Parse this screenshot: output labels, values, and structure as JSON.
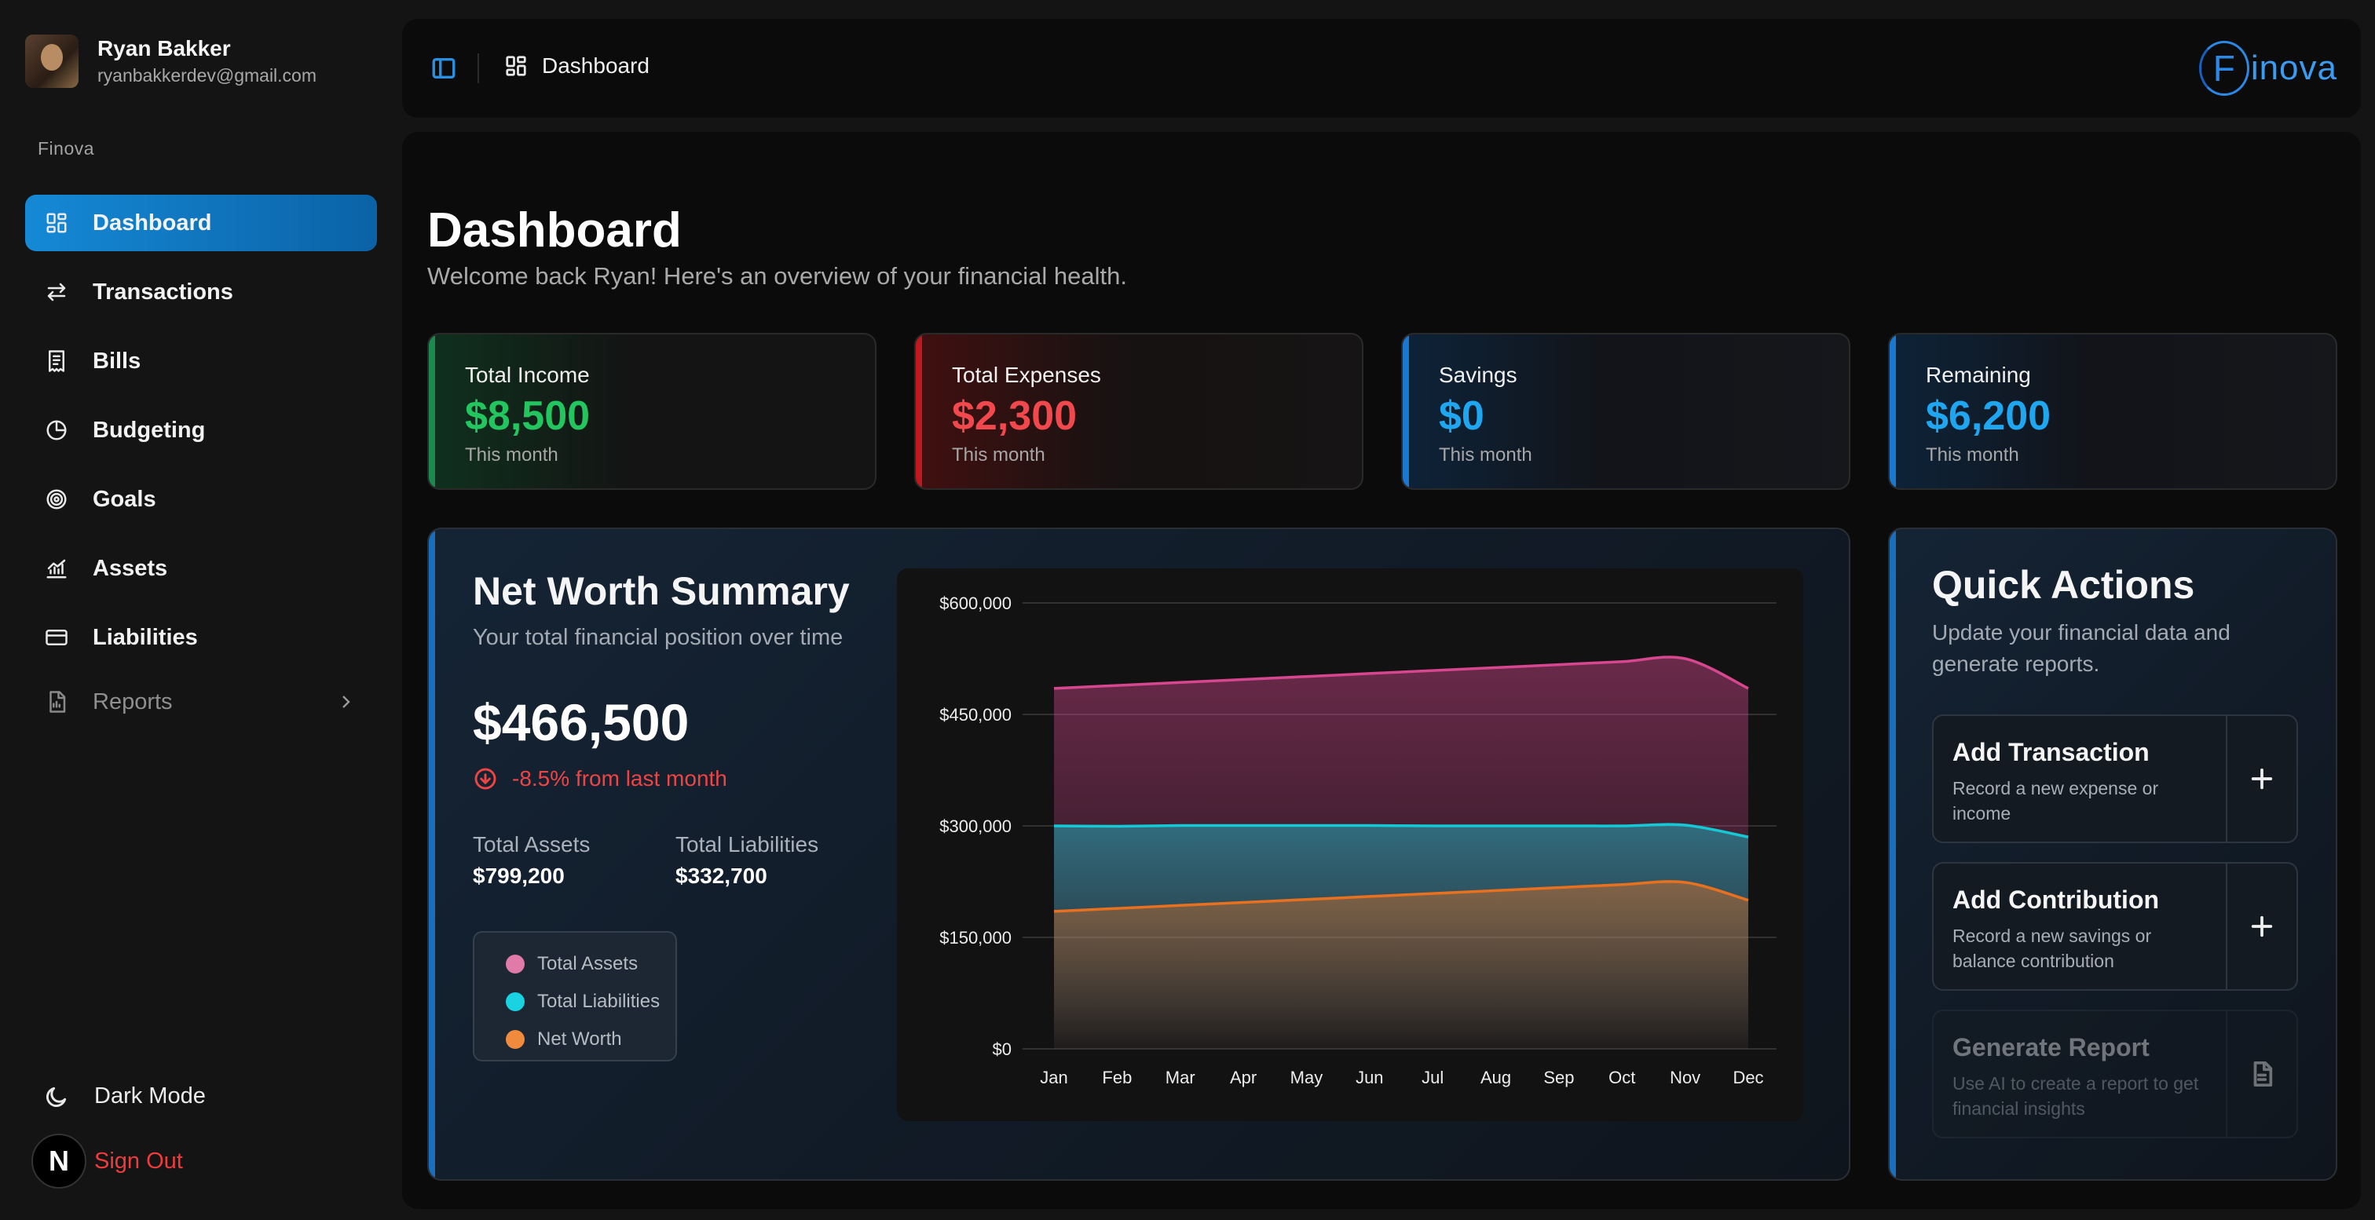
{
  "user": {
    "name": "Ryan Bakker",
    "email": "ryanbakkerdev@gmail.com"
  },
  "sidebar": {
    "section_label": "Finova",
    "items": [
      {
        "label": "Dashboard",
        "icon": "dashboard-icon",
        "active": true
      },
      {
        "label": "Transactions",
        "icon": "arrows-swap-icon"
      },
      {
        "label": "Bills",
        "icon": "receipt-icon"
      },
      {
        "label": "Budgeting",
        "icon": "pie-chart-icon"
      },
      {
        "label": "Goals",
        "icon": "target-icon"
      },
      {
        "label": "Assets",
        "icon": "bar-chart-icon"
      },
      {
        "label": "Liabilities",
        "icon": "credit-card-icon"
      },
      {
        "label": "Reports",
        "icon": "report-icon",
        "expandable": true
      }
    ],
    "dark_mode_label": "Dark Mode",
    "sign_out_label": "Sign Out",
    "badge_letter": "N"
  },
  "topbar": {
    "breadcrumb": "Dashboard",
    "logo_letter": "F",
    "logo_text": "inova"
  },
  "page": {
    "title": "Dashboard",
    "subtitle": "Welcome back Ryan! Here's an overview of your financial health."
  },
  "stats": [
    {
      "label": "Total Income",
      "value": "$8,500",
      "note": "This month",
      "color": "#22c55e"
    },
    {
      "label": "Total Expenses",
      "value": "$2,300",
      "note": "This month",
      "color": "#f0484d"
    },
    {
      "label": "Savings",
      "value": "$0",
      "note": "This month",
      "color": "#1ea7f0"
    },
    {
      "label": "Remaining",
      "value": "$6,200",
      "note": "This month",
      "color": "#1ea7f0"
    }
  ],
  "net_worth": {
    "title": "Net Worth Summary",
    "subtitle": "Your total financial position over time",
    "value": "$466,500",
    "change": "-8.5% from last month",
    "assets_label": "Total Assets",
    "assets_value": "$799,200",
    "liabilities_label": "Total Liabilities",
    "liabilities_value": "$332,700",
    "legend": [
      {
        "label": "Total Assets",
        "color": "#e07aa8"
      },
      {
        "label": "Total Liabilities",
        "color": "#19d3e0"
      },
      {
        "label": "Net Worth",
        "color": "#f08a3c"
      }
    ]
  },
  "chart_data": {
    "type": "area",
    "x": [
      "Jan",
      "Feb",
      "Mar",
      "Apr",
      "May",
      "Jun",
      "Jul",
      "Aug",
      "Sep",
      "Oct",
      "Nov",
      "Dec"
    ],
    "y_ticks": [
      "$0",
      "$150,000",
      "$300,000",
      "$450,000",
      "$600,000"
    ],
    "ylim": [
      0,
      600000
    ],
    "grid": true,
    "series": [
      {
        "name": "Total Assets",
        "color": "#d6478f",
        "values": [
          485000,
          489000,
          493000,
          497000,
          501000,
          505000,
          509000,
          513000,
          517000,
          521000,
          525000,
          485000
        ]
      },
      {
        "name": "Total Liabilities",
        "color": "#15c8d6",
        "values": [
          300000,
          299500,
          300500,
          300500,
          300500,
          300500,
          300000,
          300000,
          300000,
          300000,
          301000,
          285000
        ]
      },
      {
        "name": "Net Worth",
        "color": "#e8711f",
        "values": [
          185000,
          189000,
          193000,
          197000,
          201000,
          205000,
          209000,
          213000,
          217000,
          221000,
          224000,
          200000
        ]
      }
    ]
  },
  "quick_actions": {
    "title": "Quick Actions",
    "subtitle": "Update your financial data and generate reports.",
    "items": [
      {
        "title": "Add Transaction",
        "desc": "Record a new expense or income",
        "icon": "plus-icon"
      },
      {
        "title": "Add Contribution",
        "desc": "Record a new savings or balance contribution",
        "icon": "plus-icon"
      },
      {
        "title": "Generate Report",
        "desc": "Use AI to create a report to get financial insights",
        "icon": "document-icon",
        "disabled": true
      }
    ]
  }
}
